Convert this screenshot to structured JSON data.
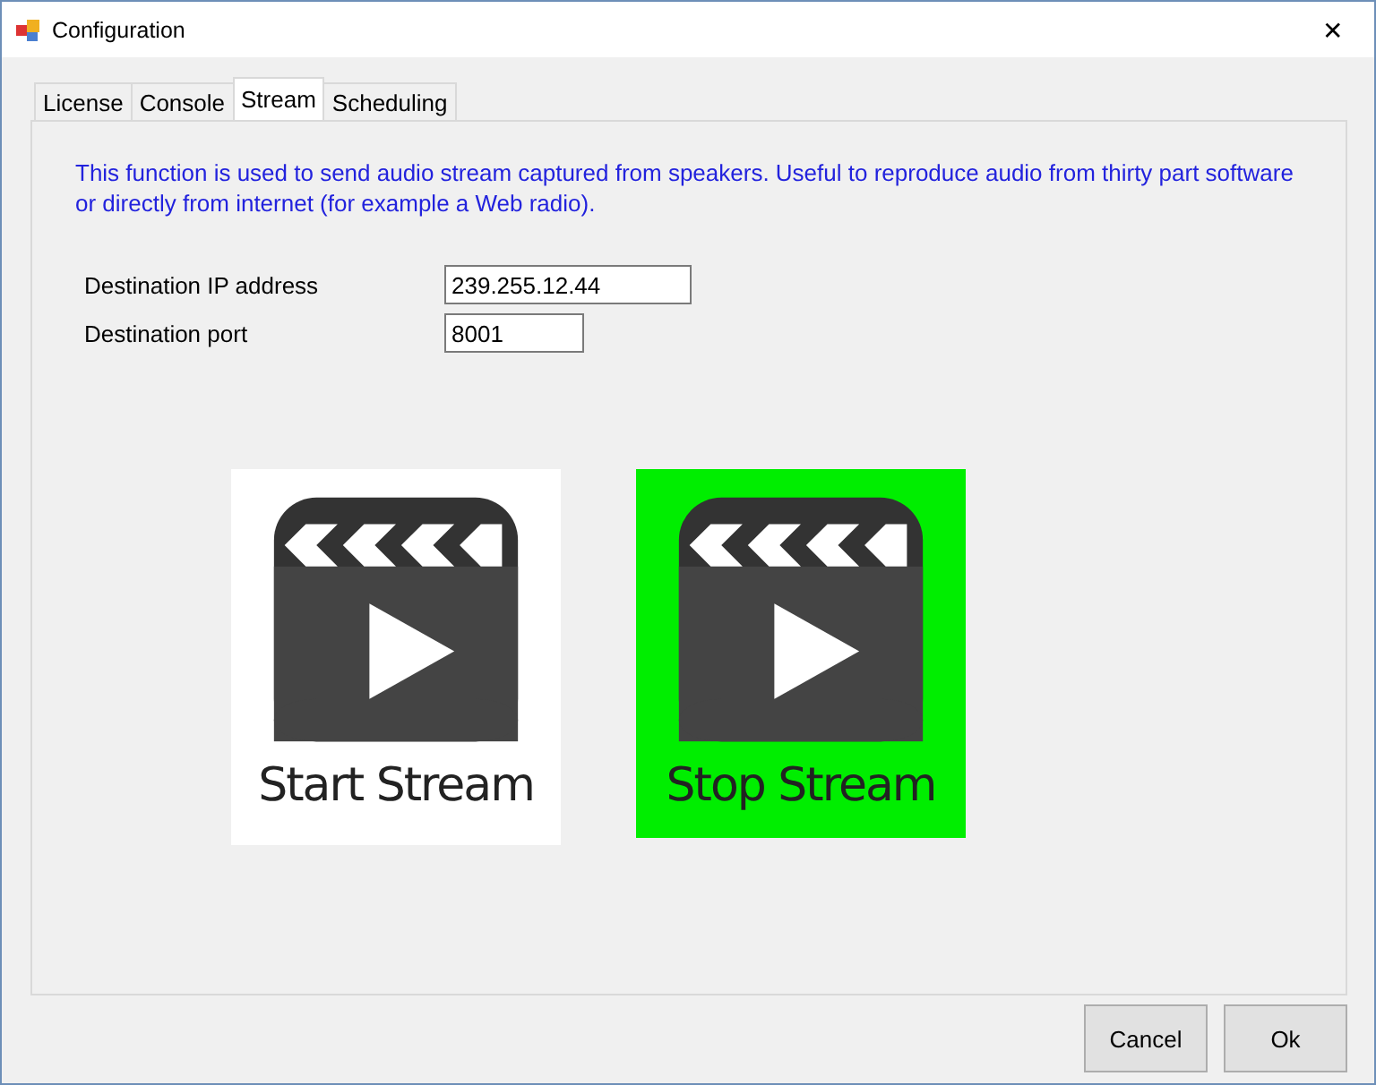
{
  "window": {
    "title": "Configuration",
    "close": "✕"
  },
  "tabs": [
    {
      "label": "License",
      "selected": false
    },
    {
      "label": "Console",
      "selected": false
    },
    {
      "label": "Stream",
      "selected": true
    },
    {
      "label": "Scheduling",
      "selected": false
    }
  ],
  "description": "This function is used to send audio stream captured from speakers. Useful to reproduce audio from thirty part software or directly from internet (for example a Web radio).",
  "fields": [
    {
      "label": "Destination IP address",
      "value": "239.255.12.44"
    },
    {
      "label": "Destination port",
      "value": "8001"
    }
  ],
  "stream_buttons": [
    {
      "label": "Start Stream",
      "active": false
    },
    {
      "label": "Stop Stream",
      "active": true
    }
  ],
  "buttons": [
    "Cancel",
    "Ok"
  ]
}
